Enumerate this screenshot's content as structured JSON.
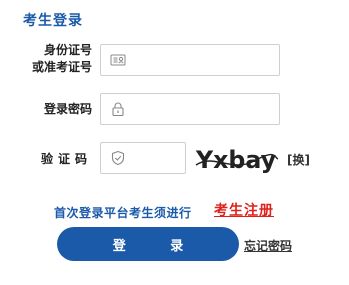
{
  "form": {
    "title": "考生登录",
    "id_label": "身份证号\n或准考证号",
    "id_value": "",
    "id_placeholder": "",
    "password_label": "登录密码",
    "password_value": "",
    "password_placeholder": "",
    "captcha_label": "验证码",
    "captcha_value": "",
    "captcha_image_text": "Yxbay",
    "refresh_label": "[换]",
    "register_prompt": "首次登录平台考生须进行",
    "register_link": "考生注册",
    "login_button": "登 录",
    "forgot_link": "忘记密码"
  },
  "colors": {
    "brand_blue": "#1a5aa8",
    "register_red": "#e0201a",
    "border_gray": "#cfcfcf"
  },
  "icons": {
    "id_field": "id-card-icon",
    "password_field": "lock-icon",
    "captcha_field": "shield-check-icon"
  }
}
